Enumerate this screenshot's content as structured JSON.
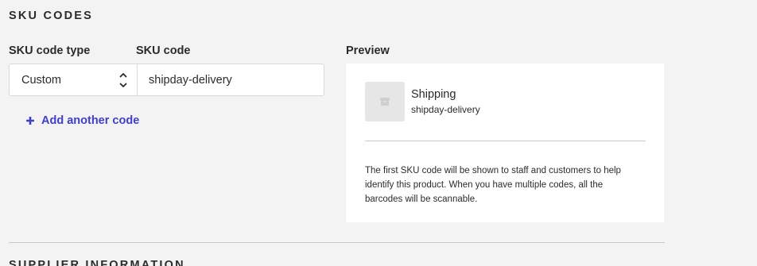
{
  "section": {
    "title": "SKU CODES"
  },
  "form": {
    "sku_type_label": "SKU code type",
    "sku_code_label": "SKU code",
    "sku_type_value": "Custom",
    "sku_code_value": "shipday-delivery",
    "add_code_label": "Add another code"
  },
  "preview": {
    "label": "Preview",
    "product_name": "Shipping",
    "product_code": "shipday-delivery",
    "thumbnail_icon": "box-icon",
    "help_text": "The first SKU code will be shown to staff and customers to help identify this product. When you have multiple codes, all the barcodes will be scannable."
  },
  "next_section": {
    "title": "SUPPLIER INFORMATION"
  },
  "colors": {
    "accent": "#3f3fc7",
    "background": "#f3f3f3",
    "card": "#ffffff"
  }
}
